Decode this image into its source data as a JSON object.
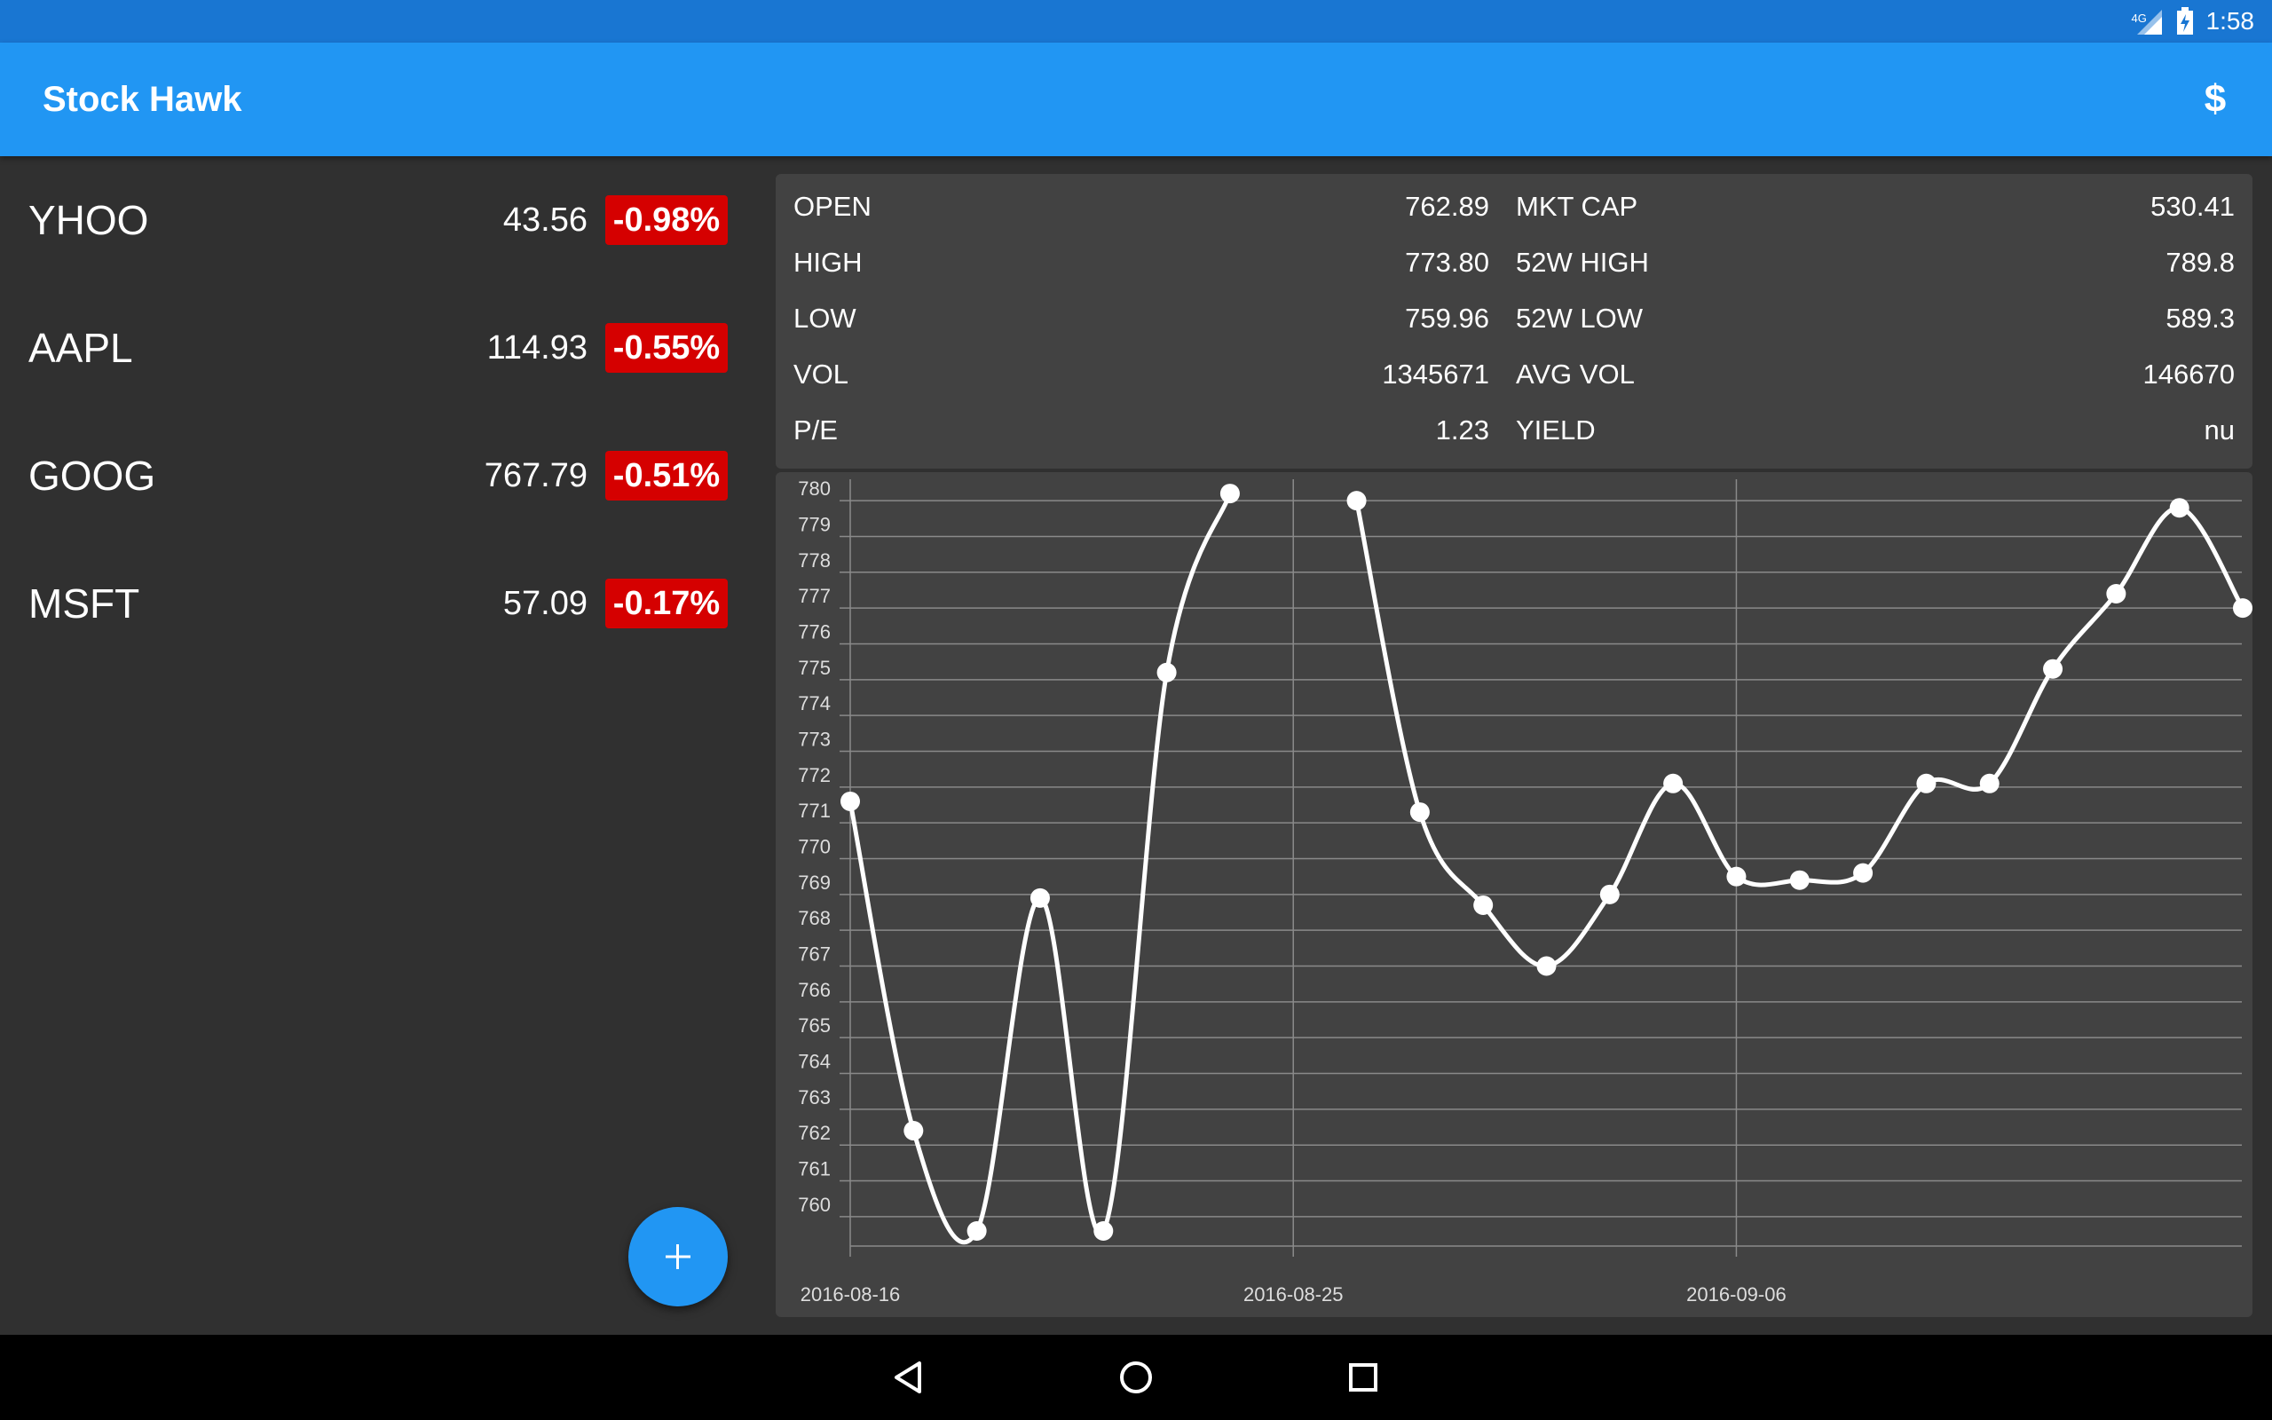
{
  "status_bar": {
    "network": "4G",
    "time": "1:58"
  },
  "app_bar": {
    "title": "Stock Hawk",
    "currency_icon": "$"
  },
  "stocks": [
    {
      "symbol": "YHOO",
      "price": "43.56",
      "change": "-0.98%"
    },
    {
      "symbol": "AAPL",
      "price": "114.93",
      "change": "-0.55%"
    },
    {
      "symbol": "GOOG",
      "price": "767.79",
      "change": "-0.51%"
    },
    {
      "symbol": "MSFT",
      "price": "57.09",
      "change": "-0.17%"
    }
  ],
  "fab": {
    "label": "+"
  },
  "details": {
    "left": [
      {
        "label": "OPEN",
        "value": "762.89"
      },
      {
        "label": "HIGH",
        "value": "773.80"
      },
      {
        "label": "LOW",
        "value": "759.96"
      },
      {
        "label": "VOL",
        "value": "1345671"
      },
      {
        "label": "P/E",
        "value": "1.23"
      }
    ],
    "right": [
      {
        "label": "MKT CAP",
        "value": "530.41"
      },
      {
        "label": "52W HIGH",
        "value": "789.8"
      },
      {
        "label": "52W LOW",
        "value": "589.3"
      },
      {
        "label": "AVG VOL",
        "value": "146670"
      },
      {
        "label": "YIELD",
        "value": "nu"
      }
    ]
  },
  "colors": {
    "status_bar": "#1976D2",
    "app_bar": "#2196F3",
    "negative": "#D50000",
    "background": "#303030",
    "card": "#424242"
  },
  "chart_data": {
    "type": "line",
    "title": "",
    "xlabel": "",
    "ylabel": "",
    "x_tick_labels": [
      "2016-08-16",
      "2016-08-25",
      "2016-09-06"
    ],
    "x_tick_indices": [
      0,
      7,
      14
    ],
    "y_ticks": [
      760,
      761,
      762,
      763,
      764,
      765,
      766,
      767,
      768,
      769,
      770,
      771,
      772,
      773,
      774,
      775,
      776,
      777,
      778,
      779,
      780
    ],
    "ylim": [
      759.6,
      780.4
    ],
    "grid": true,
    "series": [
      {
        "values": [
          771.6,
          762.4,
          759.6,
          768.9,
          759.6,
          775.2,
          780.2,
          null,
          780.0,
          771.3,
          768.7,
          767.0,
          769.0,
          772.1,
          769.5,
          769.4,
          769.6,
          772.1,
          772.1,
          775.3,
          777.4,
          779.8,
          777.0
        ]
      }
    ],
    "icons": [
      "back-icon",
      "home-icon",
      "recents-icon"
    ]
  }
}
